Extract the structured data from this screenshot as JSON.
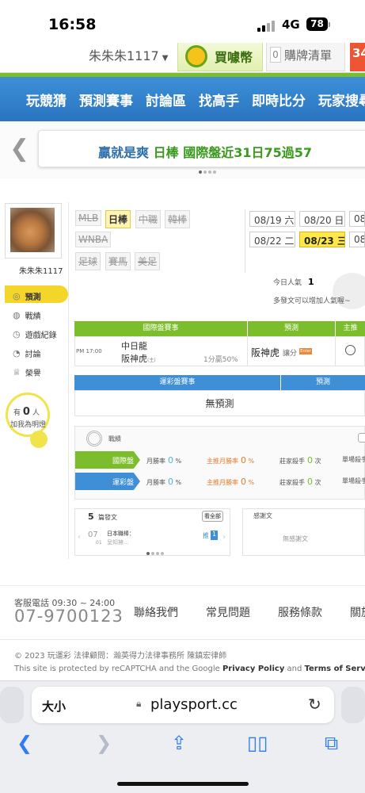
{
  "status_bar": {
    "time": "16:58",
    "network": "4G",
    "battery": "78"
  },
  "top_bar": {
    "username_dropdown": "朱朱朱1117",
    "coin_tab": "買噱幣",
    "cart_count": "0",
    "cart_label": "購牌清單",
    "badge": "34"
  },
  "nav": {
    "items": [
      "玩競猜",
      "預測賽事",
      "討論區",
      "找高手",
      "即時比分",
      "玩家搜尋"
    ]
  },
  "banner": {
    "prefix": "贏就是爽",
    "highlight": "日棒",
    "suffix": "國際盤近31日75過57"
  },
  "sidebar": {
    "username": "朱朱朱1117",
    "menu": [
      {
        "label": "預測",
        "icon": "target-icon"
      },
      {
        "label": "戰績",
        "icon": "chat-icon"
      },
      {
        "label": "遊戲紀錄",
        "icon": "clock-icon"
      },
      {
        "label": "討論",
        "icon": "discussion-icon"
      },
      {
        "label": "榮譽",
        "icon": "medal-icon"
      }
    ],
    "bulb_prefix": "有",
    "bulb_count": "0",
    "bulb_unit": "人",
    "bulb_text": "加我為明燈"
  },
  "sports": [
    "MLB",
    "日棒",
    "中職",
    "韓棒",
    "WNBA",
    "足球",
    "賽馬",
    "美足"
  ],
  "selected_sport": "日棒",
  "dates": [
    "08/19 六",
    "08/20 日",
    "08/2",
    "08/22 二",
    "08/23 三",
    "08/2"
  ],
  "selected_date": "08/23 三",
  "popularity": {
    "label": "今日人氣",
    "value": "1",
    "hint": "多發文可以增加人氣喔~"
  },
  "intl_table": {
    "headers": [
      "國際盤賽事",
      "預測",
      "主推"
    ],
    "row": {
      "time": "PM 17:00",
      "team_home": "中日龍",
      "team_away": "阪神虎",
      "away_sup": "(主)",
      "handicap": "1分贏50%",
      "prediction": "阪神虎",
      "pred_type": "讓分",
      "pred_tag": "Enter"
    }
  },
  "sports_lottery_table": {
    "headers": [
      "運彩盤賽事",
      "預測"
    ],
    "empty_text": "無預測"
  },
  "stats": {
    "title": "戰績",
    "rows": [
      {
        "tag": "國際盤",
        "month_rate_label": "月勝率",
        "month_rate": "0",
        "main_rate_label": "主推月勝率",
        "main_rate": "0",
        "killer_label": "莊家殺手",
        "killer_value": "0",
        "killer_unit": "次",
        "last_label": "單場殺手"
      },
      {
        "tag": "運彩盤",
        "month_rate_label": "月勝率",
        "month_rate": "0",
        "main_rate_label": "主推月勝率",
        "main_rate": "0",
        "killer_label": "莊家殺手",
        "killer_value": "0",
        "killer_unit": "次",
        "last_label": "單場殺手"
      }
    ],
    "percent_sign": "%"
  },
  "posts": {
    "count": "5",
    "title": "篇發文",
    "view_all": "看全部",
    "date_month": "07",
    "date_day": "01",
    "post_title": "日本職棒：",
    "post_preview": "呈知擁...",
    "push_label": "推",
    "push_count": "1"
  },
  "thanks": {
    "title": "感謝文",
    "empty": "無感謝文"
  },
  "footer": {
    "tel_label": "客服電話 09:30 ~ 24:00",
    "tel_number": "07-9700123",
    "links": [
      "聯絡我們",
      "常見問題",
      "服務條款",
      "關於"
    ],
    "copyright": "© 2023 玩運彩 法律顧問：瀚英得力法律事務所 陳鎮宏律師",
    "recaptcha_prefix": "This site is protected by reCAPTCHA and the Google ",
    "privacy": "Privacy Policy",
    "and": " and ",
    "terms": "Terms of Service"
  },
  "browser": {
    "text_size": "大小",
    "url": "playsport.cc"
  }
}
